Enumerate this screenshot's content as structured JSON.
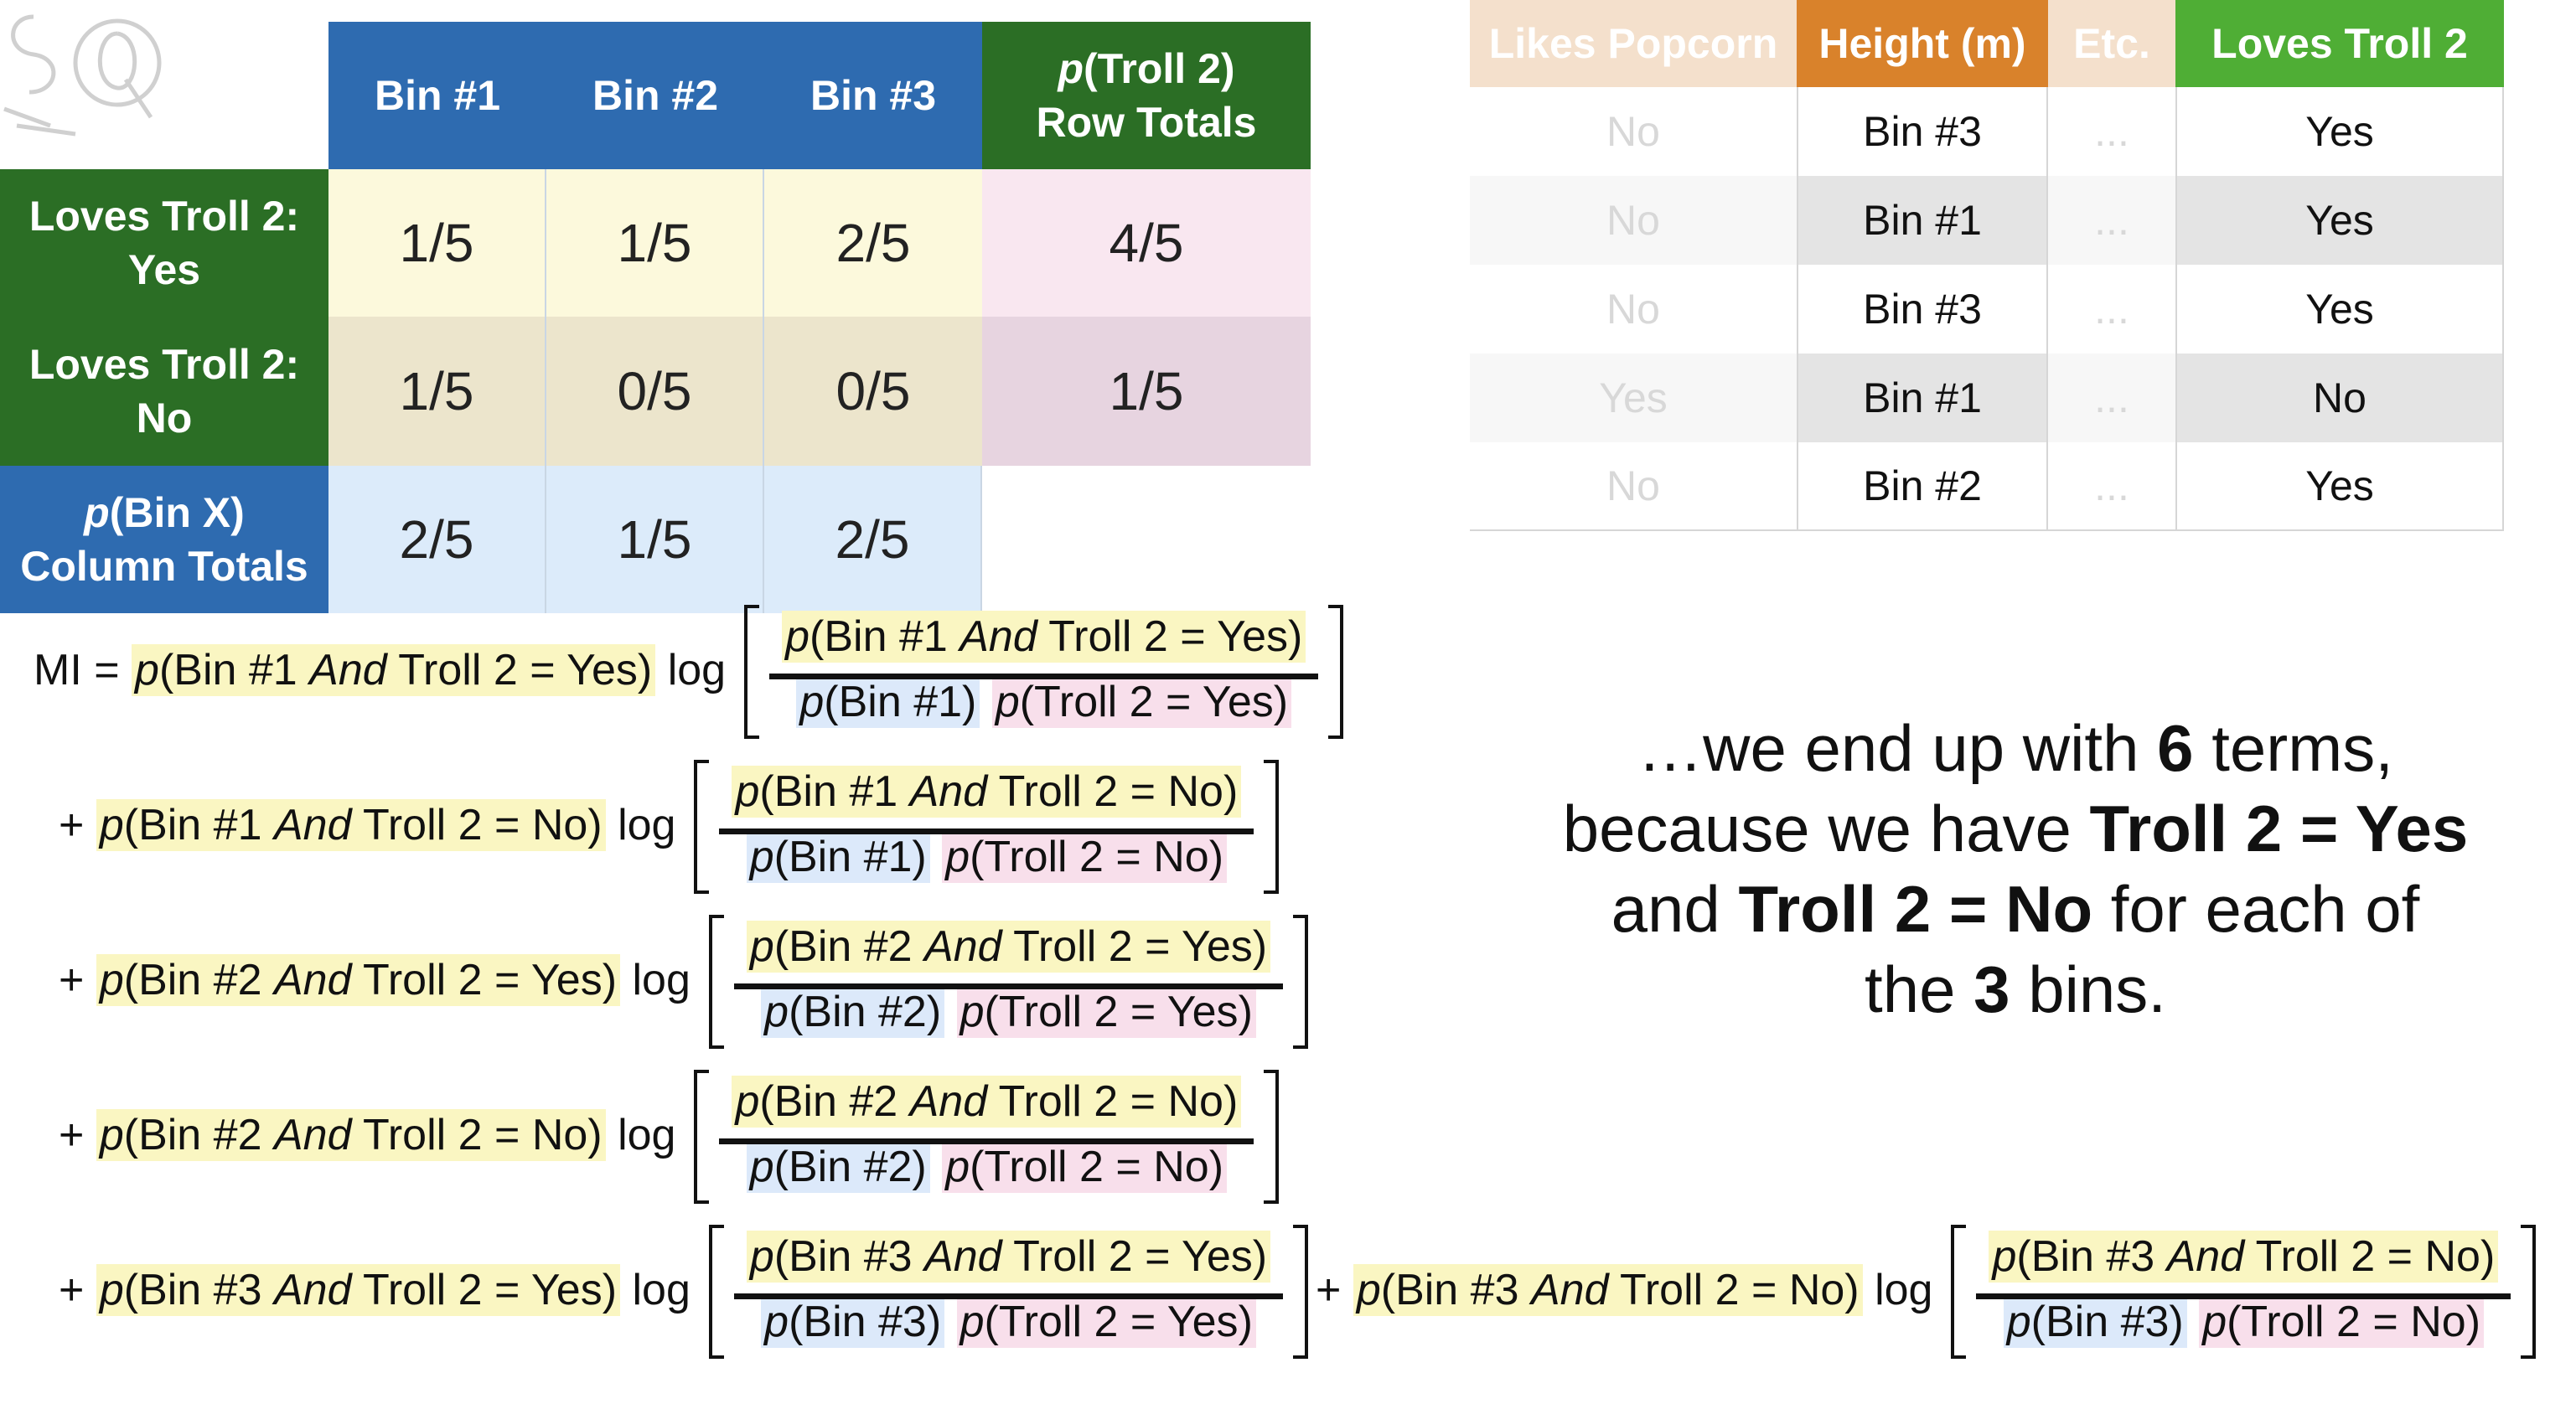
{
  "prob_table": {
    "headers": [
      "Bin #1",
      "Bin #2",
      "Bin #3"
    ],
    "row_totals_header_p": "p",
    "row_totals_header_rest": "(Troll 2)",
    "row_totals_header_line2": "Row Totals",
    "rows": [
      {
        "label_line1": "Loves Troll 2:",
        "label_line2": "Yes",
        "values": [
          "1/5",
          "1/5",
          "2/5"
        ],
        "total": "4/5"
      },
      {
        "label_line1": "Loves Troll 2:",
        "label_line2": "No",
        "values": [
          "1/5",
          "0/5",
          "0/5"
        ],
        "total": "1/5"
      }
    ],
    "col_totals_label_p": "p",
    "col_totals_label_rest": "(Bin X)",
    "col_totals_label_line2": "Column Totals",
    "col_totals": [
      "2/5",
      "1/5",
      "2/5"
    ]
  },
  "data_table": {
    "headers": [
      "Likes Popcorn",
      "Height (m)",
      "Etc.",
      "Loves Troll 2"
    ],
    "header_colors": [
      "#f4e0cc",
      "#d9822b",
      "#f4e0cc",
      "#4fae35"
    ],
    "rows": [
      [
        "No",
        "Bin #3",
        "...",
        "Yes"
      ],
      [
        "No",
        "Bin #1",
        "...",
        "Yes"
      ],
      [
        "No",
        "Bin #3",
        "...",
        "Yes"
      ],
      [
        "Yes",
        "Bin #1",
        "...",
        "No"
      ],
      [
        "No",
        "Bin #2",
        "...",
        "Yes"
      ]
    ]
  },
  "formula": {
    "lead": "MI =",
    "plus": "+",
    "log": "log",
    "terms": [
      {
        "bin": "#1",
        "troll": "Yes"
      },
      {
        "bin": "#1",
        "troll": "No"
      },
      {
        "bin": "#2",
        "troll": "Yes"
      },
      {
        "bin": "#2",
        "troll": "No"
      },
      {
        "bin": "#3",
        "troll": "Yes"
      },
      {
        "bin": "#3",
        "troll": "No"
      }
    ]
  },
  "caption": {
    "part1": "…we end up with ",
    "count": "6",
    "part2": " terms,",
    "part3": "because we have ",
    "yes": "Troll 2 = Yes",
    "part4": "and ",
    "no": "Troll 2 = No",
    "part5": " for each of",
    "part6": "the ",
    "bins": "3",
    "part7": " bins."
  }
}
